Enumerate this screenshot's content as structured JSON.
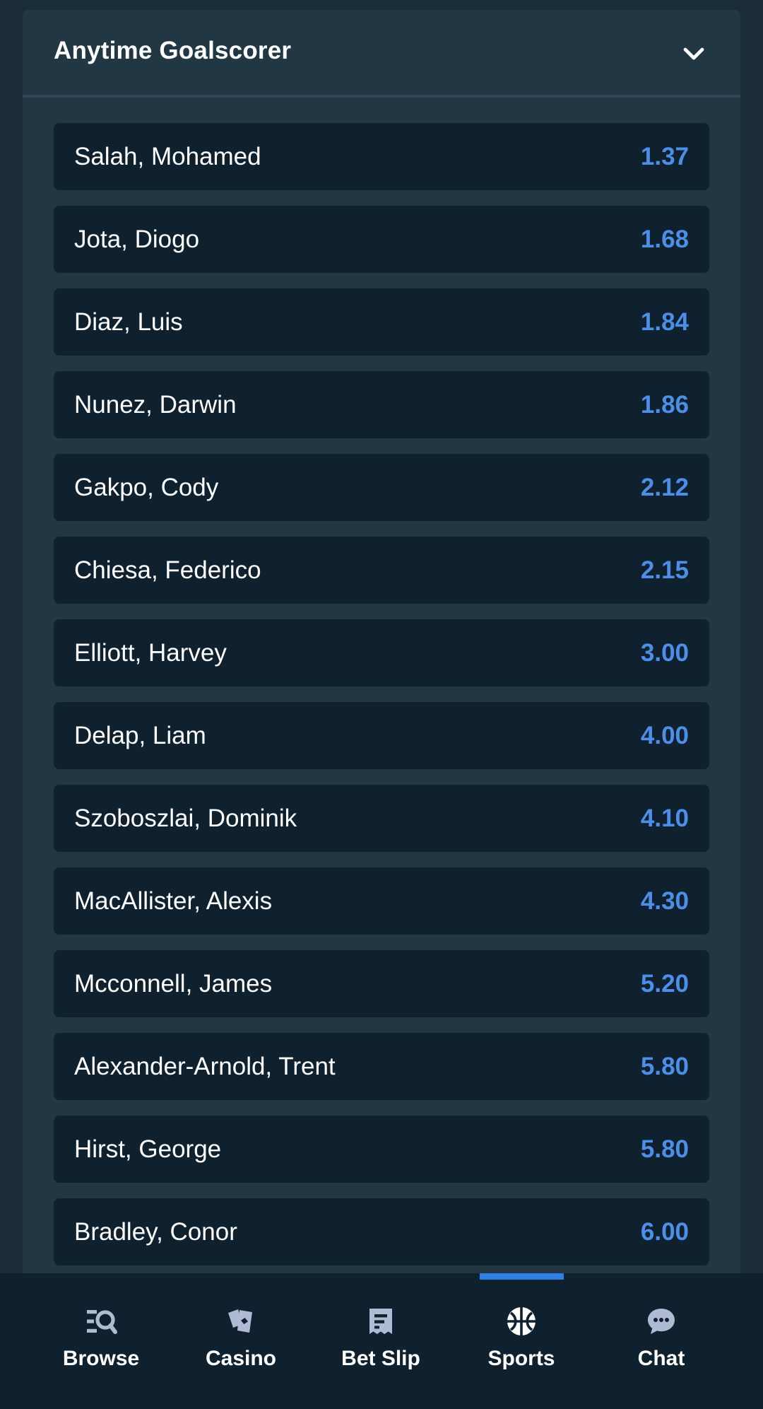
{
  "market": {
    "title": "Anytime Goalscorer"
  },
  "selections": [
    {
      "name": "Salah, Mohamed",
      "odds": "1.37"
    },
    {
      "name": "Jota, Diogo",
      "odds": "1.68"
    },
    {
      "name": "Diaz, Luis",
      "odds": "1.84"
    },
    {
      "name": "Nunez, Darwin",
      "odds": "1.86"
    },
    {
      "name": "Gakpo, Cody",
      "odds": "2.12"
    },
    {
      "name": "Chiesa, Federico",
      "odds": "2.15"
    },
    {
      "name": "Elliott, Harvey",
      "odds": "3.00"
    },
    {
      "name": "Delap, Liam",
      "odds": "4.00"
    },
    {
      "name": "Szoboszlai, Dominik",
      "odds": "4.10"
    },
    {
      "name": "MacAllister, Alexis",
      "odds": "4.30"
    },
    {
      "name": "Mcconnell, James",
      "odds": "5.20"
    },
    {
      "name": "Alexander-Arnold, Trent",
      "odds": "5.80"
    },
    {
      "name": "Hirst, George",
      "odds": "5.80"
    },
    {
      "name": "Bradley, Conor",
      "odds": "6.00"
    }
  ],
  "nav": {
    "items": [
      {
        "label": "Browse",
        "icon": "browse-search-icon"
      },
      {
        "label": "Casino",
        "icon": "casino-cards-icon"
      },
      {
        "label": "Bet Slip",
        "icon": "bet-slip-receipt-icon"
      },
      {
        "label": "Sports",
        "icon": "sports-ball-icon"
      },
      {
        "label": "Chat",
        "icon": "chat-bubble-icon"
      }
    ],
    "active": "Sports"
  },
  "colors": {
    "background": "#1a2c38",
    "card": "#213743",
    "row": "#0f212e",
    "odds": "#4d8ee8",
    "active_indicator": "#2f7ee3"
  }
}
